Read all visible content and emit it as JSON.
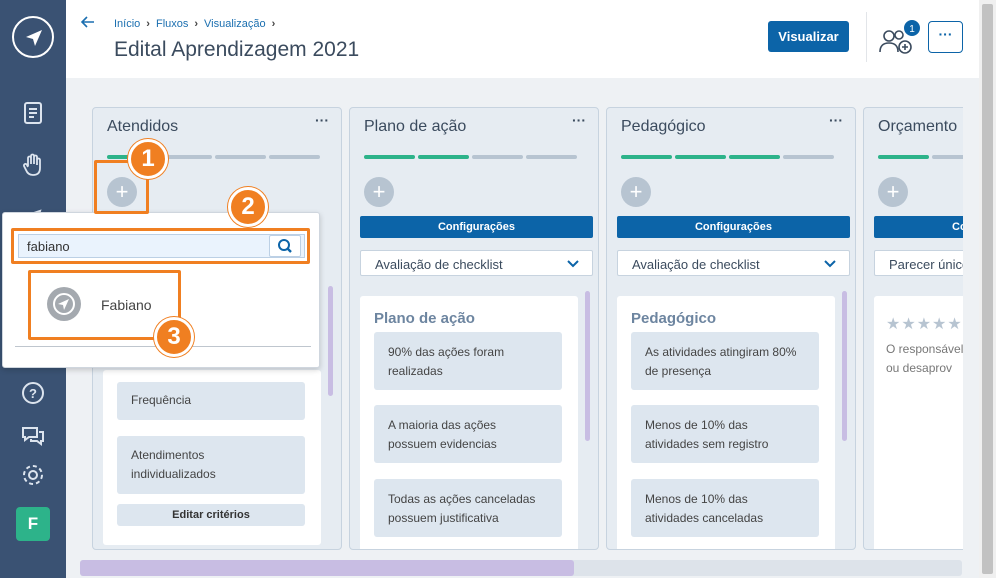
{
  "header": {
    "breadcrumb": [
      "Início",
      "Fluxos",
      "Visualização"
    ],
    "title": "Edital Aprendizagem 2021",
    "visualizar_label": "Visualizar",
    "notification_count": "1",
    "more_label": "···"
  },
  "sidebar": {
    "avatar_initial": "F",
    "icons": [
      "logo-icon",
      "document-icon",
      "hand-heart-icon",
      "help-icon",
      "chat-icon",
      "gear-icon"
    ]
  },
  "columns": [
    {
      "title": "Atendidos",
      "more": "···",
      "cards": [
        "Frequência",
        "Atendimentos individualizados"
      ],
      "edit_criteria": "Editar critérios"
    },
    {
      "title": "Plano de ação",
      "more": "···",
      "config": "Configurações",
      "select": "Avaliação de checklist",
      "panel_title": "Plano de ação",
      "cards": [
        "90% das ações foram realizadas",
        "A maioria das ações possuem evidencias",
        "Todas as ações canceladas possuem justificativa"
      ]
    },
    {
      "title": "Pedagógico",
      "more": "···",
      "config": "Configurações",
      "select": "Avaliação de checklist",
      "panel_title": "Pedagógico",
      "cards": [
        "As atividades atingiram 80% de presença",
        "Menos de 10% das atividades sem registro",
        "Menos de 10% das atividades canceladas"
      ]
    },
    {
      "title": "Orçamento",
      "more": "···",
      "config": "Configurações",
      "select": "Parecer único",
      "stars": "★★★★★",
      "note": [
        "O responsável",
        "ou desaprov"
      ]
    }
  ],
  "dropdown": {
    "search_value": "fabiano",
    "result_name": "Fabiano"
  },
  "markers": [
    "1",
    "2",
    "3"
  ],
  "colors": {
    "sidebar": "#3a5273",
    "primary": "#0c64a8",
    "progress_done": "#2db38a",
    "progress_todo": "#b7c4d1",
    "highlight": "#f07f21"
  }
}
